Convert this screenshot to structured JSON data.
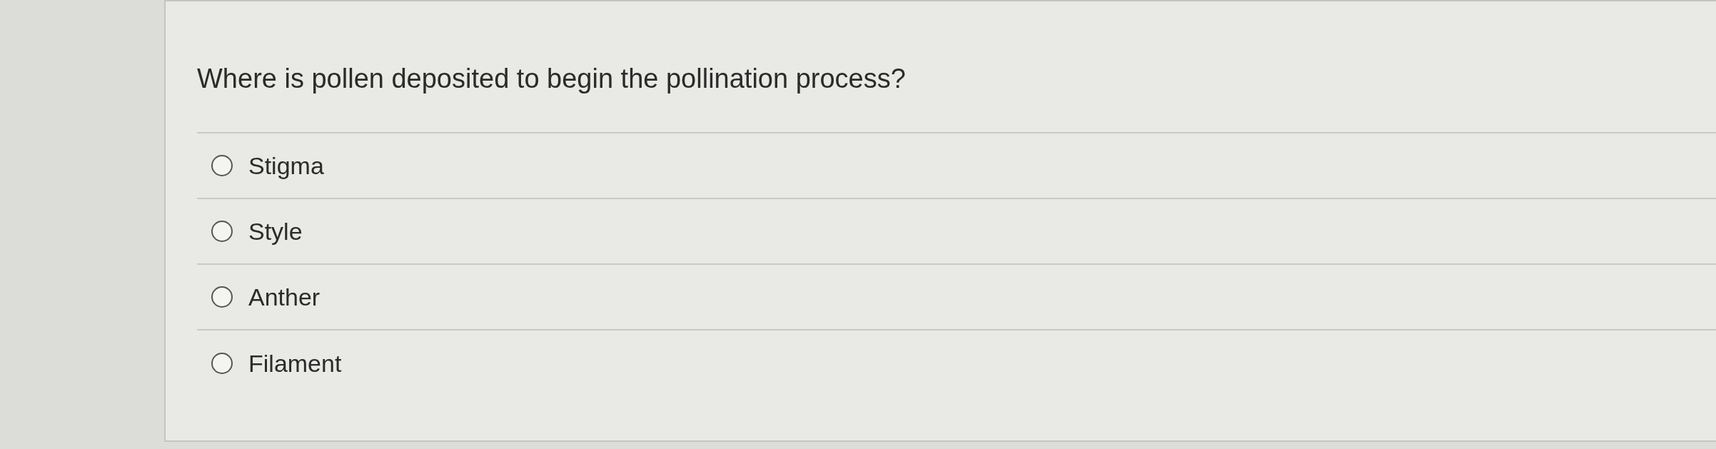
{
  "question": "Where is pollen deposited to begin the pollination process?",
  "options": [
    {
      "label": "Stigma",
      "selected": false
    },
    {
      "label": "Style",
      "selected": false
    },
    {
      "label": "Anther",
      "selected": false
    },
    {
      "label": "Filament",
      "selected": false
    }
  ]
}
